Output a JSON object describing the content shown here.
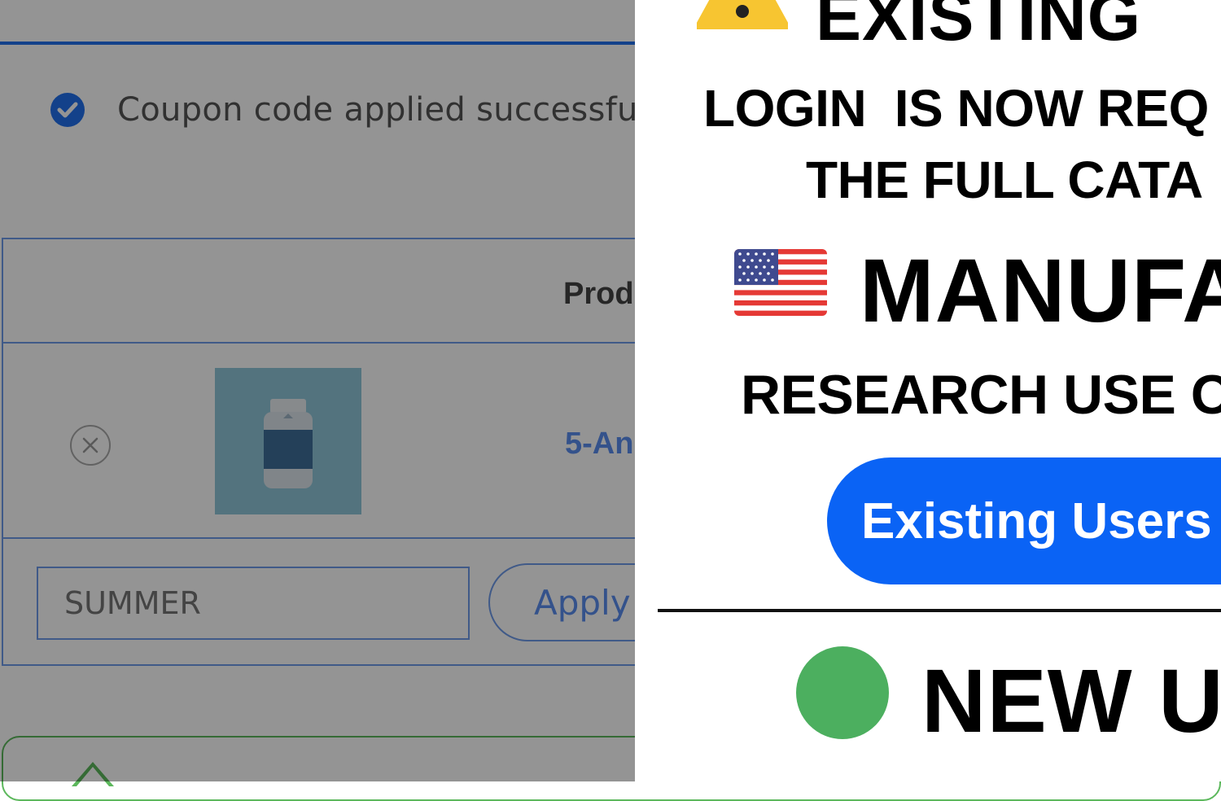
{
  "cart": {
    "notice_text": "Coupon code applied successfully.",
    "table_header_product": "Prod",
    "product_name": "5-An",
    "coupon_placeholder": "SUMMER",
    "apply_label": "Apply c"
  },
  "modal": {
    "heading": "EXISTING",
    "line1": "LOGIN  IS NOW REQ",
    "line2": "THE FULL CATA",
    "manuf": "MANUFA",
    "research": "RESEARCH USE O",
    "existing_btn": "Existing Users",
    "new_heading": "NEW U"
  },
  "colors": {
    "accent_blue": "#2271ee",
    "button_blue": "#0a63f5",
    "success_green": "#4caf5f",
    "warning_yellow": "#f7c531"
  },
  "icons": {
    "notice": "check-circle-icon",
    "remove": "close-circle-icon",
    "warning": "warning-triangle-icon",
    "flag": "us-flag-icon",
    "status": "green-dot-icon"
  }
}
